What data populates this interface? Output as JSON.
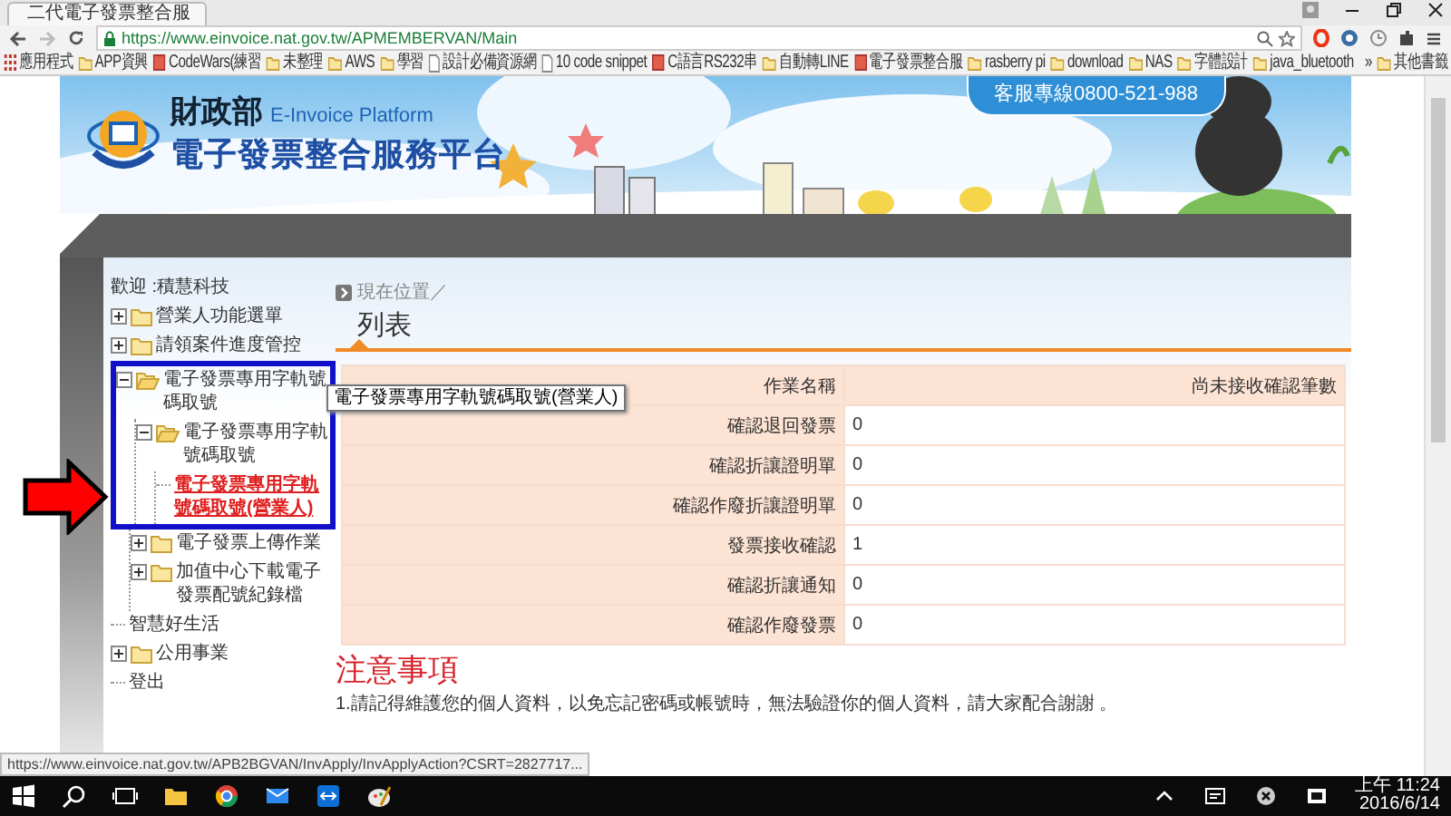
{
  "browser": {
    "tab": {
      "title": "二代電子發票整合服"
    },
    "address": "https://www.einvoice.nat.gov.tw/APMEMBERVAN/Main",
    "bookmarks": [
      {
        "kind": "apps",
        "label": "應用程式"
      },
      {
        "kind": "folder",
        "label": "APP資興"
      },
      {
        "kind": "site",
        "label": "CodeWars(練習"
      },
      {
        "kind": "folder",
        "label": "未整理"
      },
      {
        "kind": "folder",
        "label": "AWS"
      },
      {
        "kind": "folder",
        "label": "學習"
      },
      {
        "kind": "page",
        "label": "設計必備資源網"
      },
      {
        "kind": "page",
        "label": "10 code snippet"
      },
      {
        "kind": "site",
        "label": "C語言RS232串"
      },
      {
        "kind": "folder",
        "label": "自動轉LINE"
      },
      {
        "kind": "site",
        "label": "電子發票整合服"
      },
      {
        "kind": "folder",
        "label": "rasberry pi"
      },
      {
        "kind": "folder",
        "label": "download"
      },
      {
        "kind": "folder",
        "label": "NAS"
      },
      {
        "kind": "folder",
        "label": "字體設計"
      },
      {
        "kind": "folder",
        "label": "java_bluetooth"
      }
    ],
    "more": "»",
    "other_bookmarks": "其他書籤"
  },
  "banner": {
    "agency": "財政部",
    "platform": "E-Invoice Platform",
    "title": "電子發票整合服務平台",
    "hotline": "客服專線0800-521-988"
  },
  "sidebar": {
    "welcome": "歡迎 :積慧科技",
    "items": [
      {
        "kind": "folder",
        "label": "營業人功能選單",
        "expanded": false,
        "selected": false,
        "highlighted": false
      },
      {
        "kind": "folder",
        "label": "請領案件進度管控",
        "expanded": false,
        "selected": false,
        "highlighted": false
      },
      {
        "kind": "folder",
        "label": "電子發票專用字軌號碼取號",
        "expanded": true,
        "selected": false,
        "highlighted": true,
        "children": [
          {
            "kind": "folder",
            "label": "電子發票專用字軌號碼取號",
            "expanded": true,
            "selected": false,
            "highlighted": false,
            "children": [
              {
                "kind": "leaf",
                "label": "電子發票專用字軌號碼取號(營業人)",
                "selected": true,
                "highlighted": false
              }
            ]
          },
          {
            "kind": "folder",
            "label": "電子發票上傳作業",
            "expanded": false,
            "selected": false,
            "highlighted": false
          },
          {
            "kind": "folder",
            "label": "加值中心下載電子發票配號紀錄檔",
            "expanded": false,
            "selected": false,
            "highlighted": false
          }
        ]
      },
      {
        "kind": "leaf",
        "label": "智慧好生活",
        "selected": false,
        "highlighted": false
      },
      {
        "kind": "folder",
        "label": "公用事業",
        "expanded": false,
        "selected": false,
        "highlighted": false
      },
      {
        "kind": "leaf",
        "label": "登出",
        "selected": false,
        "highlighted": false
      }
    ]
  },
  "tooltip": "電子發票專用字軌號碼取號(營業人)",
  "main": {
    "breadcrumb": "現在位置／",
    "heading": "列表",
    "table": {
      "columns": [
        "作業名稱",
        "尚未接收確認筆數"
      ],
      "rows": [
        {
          "name": "確認退回發票",
          "count": "0"
        },
        {
          "name": "確認折讓證明單",
          "count": "0"
        },
        {
          "name": "確認作廢折讓證明單",
          "count": "0"
        },
        {
          "name": "發票接收確認",
          "count": "1"
        },
        {
          "name": "確認折讓通知",
          "count": "0"
        },
        {
          "name": "確認作廢發票",
          "count": "0"
        }
      ]
    },
    "notice_title": "注意事項",
    "notices": [
      "1.請記得維護您的個人資料，以免忘記密碼或帳號時，無法驗證你的個人資料，請大家配合謝謝 。"
    ]
  },
  "status_bar": "https://www.einvoice.nat.gov.tw/APB2BGVAN/InvApply/InvApplyAction?CSRT=2827717...",
  "taskbar": {
    "time": "上午 11:24",
    "date": "2016/6/14"
  }
}
